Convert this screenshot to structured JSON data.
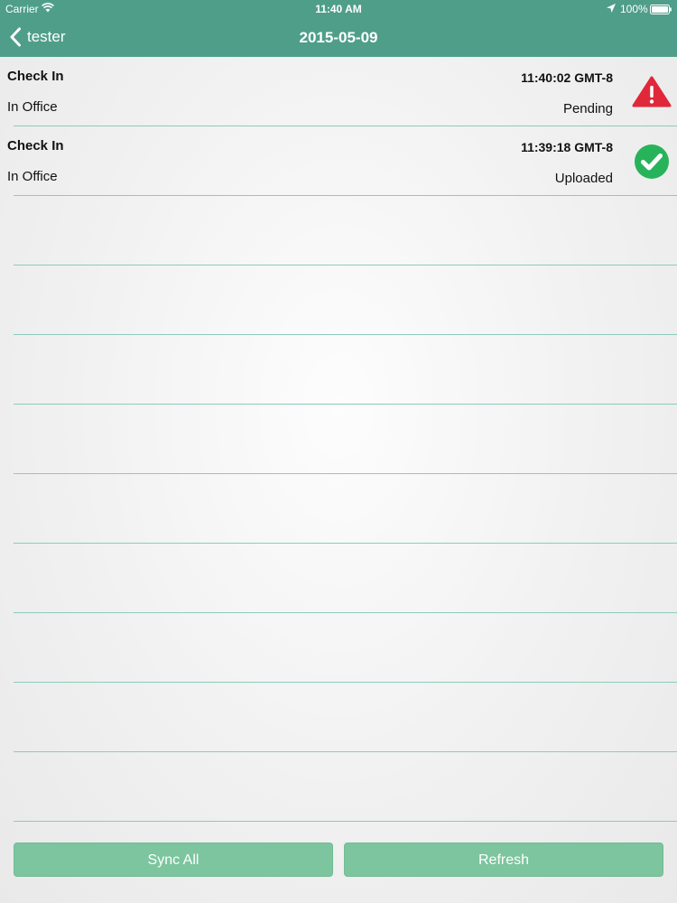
{
  "status_bar": {
    "carrier": "Carrier",
    "time": "11:40 AM",
    "battery": "100%"
  },
  "nav": {
    "back_label": "tester",
    "title": "2015-05-09"
  },
  "rows": [
    {
      "title": "Check In",
      "subtitle": "In Office",
      "time": "11:40:02 GMT-8",
      "status": "Pending",
      "icon": "warning-icon"
    },
    {
      "title": "Check In",
      "subtitle": "In Office",
      "time": "11:39:18 GMT-8",
      "status": "Uploaded",
      "icon": "check-circle-icon"
    },
    {},
    {},
    {},
    {},
    {},
    {},
    {},
    {},
    {}
  ],
  "buttons": {
    "sync_all": "Sync All",
    "refresh": "Refresh"
  },
  "colors": {
    "nav_bar": "#4f9e8a",
    "separator": "#8ccbbd",
    "button": "#7cc59e",
    "warning": "#e0283a",
    "success": "#27b35a"
  }
}
